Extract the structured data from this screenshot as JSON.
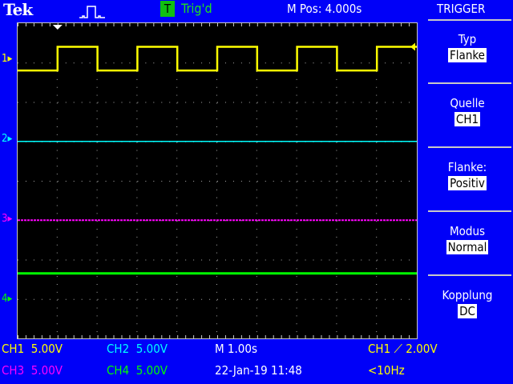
{
  "header": {
    "brand": "Tek",
    "trigger_badge": "T",
    "trigger_status": "Trig'd",
    "m_pos": "M Pos: 4.000s"
  },
  "trigger_menu": {
    "title": "TRIGGER",
    "items": [
      {
        "label": "Typ",
        "value": "Flanke"
      },
      {
        "label": "Quelle",
        "value": "CH1"
      },
      {
        "label": "Flanke:",
        "value": "Positiv"
      },
      {
        "label": "Modus",
        "value": "Normal"
      },
      {
        "label": "Kopplung",
        "value": "DC"
      }
    ]
  },
  "channels": [
    {
      "name": "CH1",
      "scale": "5.00V",
      "color": "#ffff00",
      "marker": "1"
    },
    {
      "name": "CH2",
      "scale": "5.00V",
      "color": "#00ffff",
      "marker": "2"
    },
    {
      "name": "CH3",
      "scale": "5.00V",
      "color": "#ff00ff",
      "marker": "3"
    },
    {
      "name": "CH4",
      "scale": "5.00V",
      "color": "#00ff00",
      "marker": "4"
    }
  ],
  "timebase": "M 1.00s",
  "datetime": "22-Jan-19 11:48",
  "trigger_readout": {
    "source": "CH1",
    "slope_icon": "rising-edge",
    "level": "2.00V"
  },
  "frequency": "<10Hz",
  "waveform": {
    "ch1_period_div": 2,
    "ch1_duty": 0.5,
    "ch1_first_rise_div": 1,
    "ch1_high_div": 3.4,
    "ch1_low_div": 2.8,
    "ch2_level_div": 1,
    "ch3_level_div": -1,
    "ch4_level_div": -2.35
  }
}
